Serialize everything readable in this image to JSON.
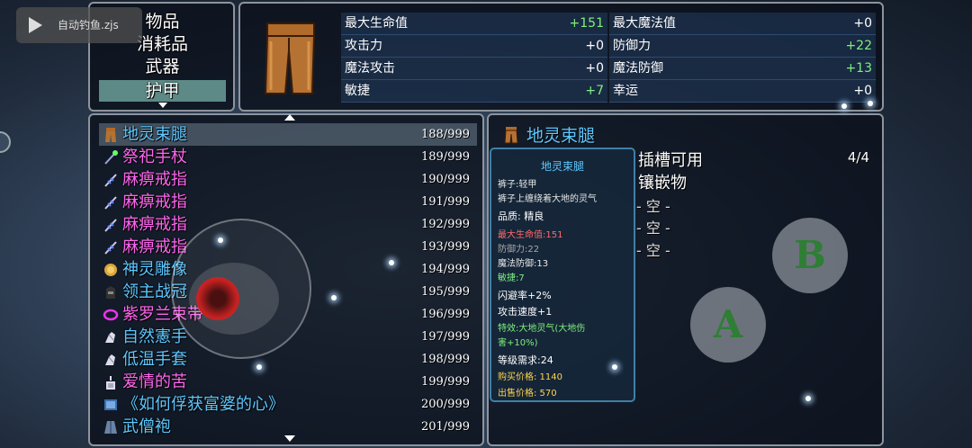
{
  "overlay": {
    "script_label": "自动钓鱼.zjs"
  },
  "categories": [
    {
      "label": "物品",
      "selected": false
    },
    {
      "label": "消耗品",
      "selected": false
    },
    {
      "label": "武器",
      "selected": false
    },
    {
      "label": "护甲",
      "selected": true
    }
  ],
  "stats": {
    "left": [
      {
        "label": "最大生命值",
        "value": "+151",
        "color": "green"
      },
      {
        "label": "攻击力",
        "value": "+0",
        "color": "white"
      },
      {
        "label": "魔法攻击",
        "value": "+0",
        "color": "white"
      },
      {
        "label": "敏捷",
        "value": "+7",
        "color": "green"
      }
    ],
    "right": [
      {
        "label": "最大魔法值",
        "value": "+0",
        "color": "white"
      },
      {
        "label": "防御力",
        "value": "+22",
        "color": "green"
      },
      {
        "label": "魔法防御",
        "value": "+13",
        "color": "green"
      },
      {
        "label": "幸运",
        "value": "+0",
        "color": "white"
      }
    ]
  },
  "items": [
    {
      "name": "地灵束腿",
      "count": "188/999",
      "color": "#5ec8ff",
      "icon": "pants-icon",
      "selected": true
    },
    {
      "name": "祭祀手杖",
      "count": "189/999",
      "color": "#ff66ee",
      "icon": "staff-icon",
      "selected": false
    },
    {
      "name": "麻痹戒指",
      "count": "190/999",
      "color": "#ff66ee",
      "icon": "ring-icon",
      "selected": false
    },
    {
      "name": "麻痹戒指",
      "count": "191/999",
      "color": "#ff66ee",
      "icon": "ring-icon",
      "selected": false
    },
    {
      "name": "麻痹戒指",
      "count": "192/999",
      "color": "#ff66ee",
      "icon": "ring-icon",
      "selected": false
    },
    {
      "name": "麻痹戒指",
      "count": "193/999",
      "color": "#ff66ee",
      "icon": "ring-icon",
      "selected": false
    },
    {
      "name": "神灵雕像",
      "count": "194/999",
      "color": "#5ec8ff",
      "icon": "statue-icon",
      "selected": false
    },
    {
      "name": "领主战冠",
      "count": "195/999",
      "color": "#5ec8ff",
      "icon": "crown-icon",
      "selected": false
    },
    {
      "name": "紫罗兰束带",
      "count": "196/999",
      "color": "#ff66ee",
      "icon": "belt-icon",
      "selected": false
    },
    {
      "name": "自然憲手",
      "count": "197/999",
      "color": "#5ec8ff",
      "icon": "glove-icon",
      "selected": false
    },
    {
      "name": "低温手套",
      "count": "198/999",
      "color": "#5ec8ff",
      "icon": "glove-icon",
      "selected": false
    },
    {
      "name": "爱情的苦",
      "count": "199/999",
      "color": "#ff66ee",
      "icon": "potion-icon",
      "selected": false
    },
    {
      "name": "《如何俘获富婆的心》",
      "count": "200/999",
      "color": "#5ec8ff",
      "icon": "book-icon",
      "selected": false
    },
    {
      "name": "武僧袍",
      "count": "201/999",
      "color": "#5ec8ff",
      "icon": "robe-icon",
      "selected": false
    }
  ],
  "detail": {
    "title": "地灵束腿",
    "socket_label": "插槽可用",
    "socket_count": "4/4",
    "inlay_label": "镶嵌物",
    "slots": [
      "- 空 -",
      "- 空 -",
      "- 空 -"
    ]
  },
  "tooltip": {
    "name": "地灵束腿",
    "type": "裤子:轻甲",
    "desc": "裤子上缠绕着大地的灵气",
    "quality": "品质: 精良",
    "hp": "最大生命值:151",
    "def": "防御力:22",
    "mdef": "魔法防御:13",
    "agi": "敏捷:7",
    "dodge": "闪避率+2%",
    "atk_speed": "攻击速度+1",
    "special_1": "特效:大地灵气(大地伤",
    "special_2": "害+10%)",
    "level_req": "等级需求:24",
    "buy": "购买价格: 1140",
    "sell": "出售价格: 570"
  },
  "controls": {
    "a_label": "A",
    "b_label": "B"
  }
}
